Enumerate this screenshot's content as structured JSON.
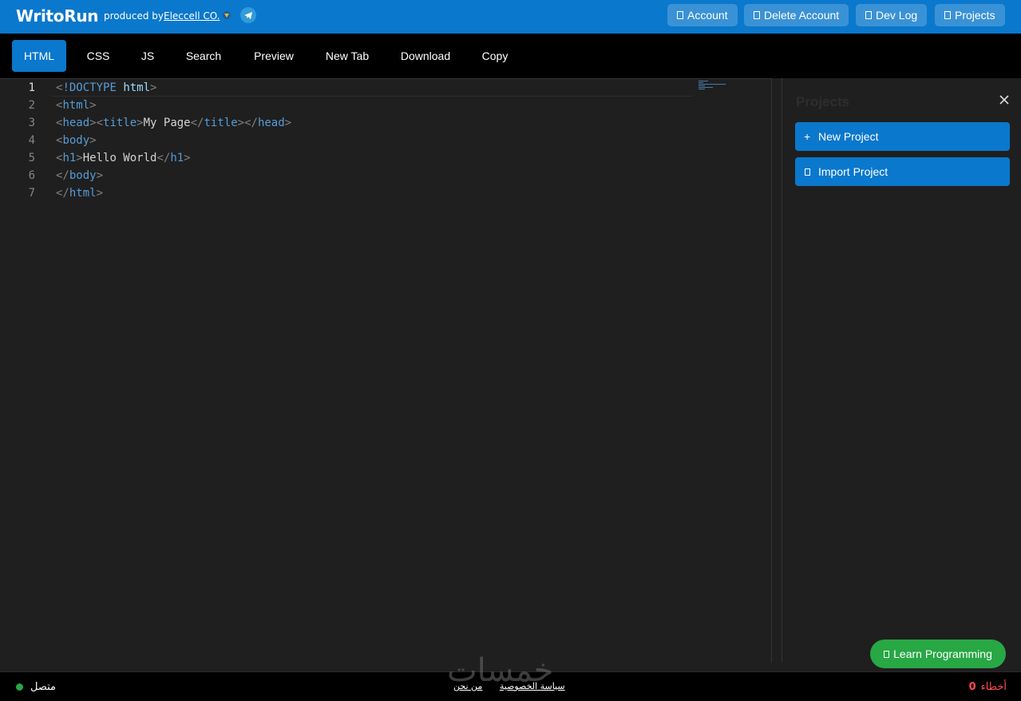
{
  "header": {
    "brand": "WritoRun",
    "produced_by": "produced by",
    "company": "Eleccell CO.",
    "buttons": [
      "Account",
      "Delete Account",
      "Dev Log",
      "Projects"
    ]
  },
  "tabs": [
    "HTML",
    "CSS",
    "JS",
    "Search",
    "Preview",
    "New Tab",
    "Download",
    "Copy"
  ],
  "active_tab": "HTML",
  "editor": {
    "line_numbers": [
      "1",
      "2",
      "3",
      "4",
      "5",
      "6",
      "7"
    ],
    "current_line": 1
  },
  "side_panel": {
    "title": "Projects",
    "new_project": "New Project",
    "new_project_icon": "+",
    "import_project": "Import Project"
  },
  "learn_button": "Learn Programming",
  "status": {
    "connection": "متصل",
    "links": [
      "سياسة الخصوصية",
      "من نحن"
    ],
    "errors_label": "أخطاء",
    "errors_count": "0",
    "watermark": "خمسات"
  },
  "colors": {
    "accent": "#0a78cc",
    "success": "#28a745",
    "error": "#ff4d4d",
    "tag": "#569cd6",
    "editor_bg": "#1f1f1f"
  }
}
